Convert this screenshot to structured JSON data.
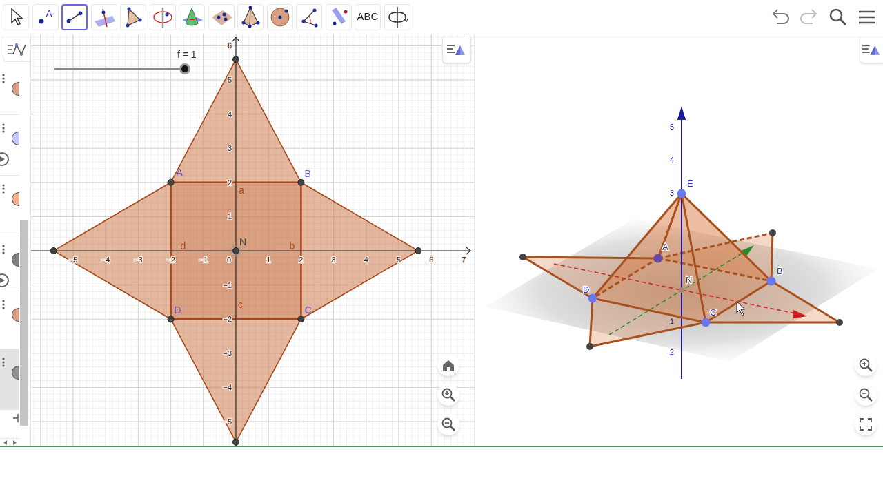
{
  "toolbar": {
    "tools": [
      {
        "kind": "move",
        "selected": false
      },
      {
        "kind": "point",
        "label": "A",
        "selected": false
      },
      {
        "kind": "segment",
        "selected": true
      },
      {
        "kind": "plane_line",
        "selected": false
      },
      {
        "kind": "polygon",
        "selected": false
      },
      {
        "kind": "rotate_axis",
        "selected": false
      },
      {
        "kind": "cone",
        "selected": false
      },
      {
        "kind": "plane_points",
        "selected": false
      },
      {
        "kind": "pyramid",
        "selected": false
      },
      {
        "kind": "sphere",
        "selected": false
      },
      {
        "kind": "angle",
        "selected": false
      },
      {
        "kind": "reflect",
        "selected": false
      },
      {
        "kind": "text",
        "label": "ABC",
        "selected": false
      },
      {
        "kind": "rotate_view",
        "selected": false
      }
    ]
  },
  "top_actions": [
    {
      "kind": "undo"
    },
    {
      "kind": "redo"
    },
    {
      "kind": "search"
    },
    {
      "kind": "menu"
    }
  ],
  "algebra_view": {
    "items": [
      {
        "color": "#d9a08a",
        "play_button": false,
        "selected": false
      },
      {
        "color": "#c8c8ff",
        "play_button": true,
        "selected": false
      },
      {
        "color": "#f0b08c",
        "play_button": false,
        "selected": false
      },
      {
        "color": "#808080",
        "play_button": true,
        "selected": false
      },
      {
        "color": "#d9a08a",
        "play_button": false,
        "selected": false
      },
      {
        "color": "#909090",
        "play_button": false,
        "selected": true
      }
    ]
  },
  "graphics_2d": {
    "slider": {
      "label": "f = 1",
      "level": 1
    },
    "x_ticks": [
      "−5",
      "−4",
      "−3",
      "−2",
      "−1",
      "0",
      "1",
      "2",
      "3",
      "4",
      "5",
      "6",
      "7"
    ],
    "y_ticks": [
      "6",
      "5",
      "4",
      "3",
      "2",
      "1",
      "−1",
      "−2",
      "−3",
      "−4",
      "−5"
    ],
    "points": [
      {
        "label": "A"
      },
      {
        "label": "B"
      },
      {
        "label": "C"
      },
      {
        "label": "D"
      },
      {
        "label": "N"
      }
    ],
    "segments": [
      {
        "label": "a"
      },
      {
        "label": "b"
      },
      {
        "label": "c"
      },
      {
        "label": "d"
      }
    ],
    "buttons": [
      {
        "kind": "style_bar"
      },
      {
        "kind": "home"
      },
      {
        "kind": "zoom_in"
      },
      {
        "kind": "zoom_out"
      }
    ]
  },
  "graphics_3d": {
    "z_ticks": [
      "5",
      "4",
      "3",
      "-1",
      "-2"
    ],
    "points": [
      {
        "label": "E"
      },
      {
        "label": "A"
      },
      {
        "label": "B"
      },
      {
        "label": "C"
      },
      {
        "label": "D"
      },
      {
        "label": "N"
      }
    ],
    "buttons": [
      {
        "kind": "style_bar"
      },
      {
        "kind": "zoom_in"
      },
      {
        "kind": "zoom_out"
      },
      {
        "kind": "fullscreen"
      }
    ]
  }
}
